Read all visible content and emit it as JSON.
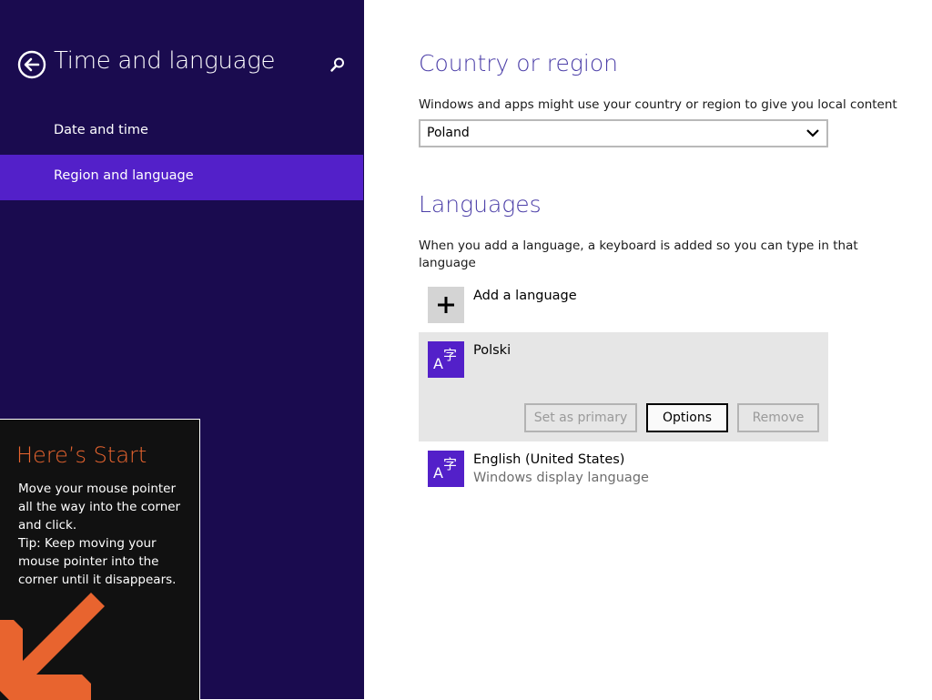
{
  "sidebar": {
    "title": "Time and language",
    "items": [
      {
        "label": "Date and time",
        "selected": false
      },
      {
        "label": "Region and language",
        "selected": true
      }
    ]
  },
  "tip": {
    "title": "Here’s Start",
    "lines": [
      "Move your mouse pointer",
      "all the way into the corner",
      "and click.",
      "Tip: Keep moving your",
      "mouse pointer into the",
      "corner until it disappears."
    ]
  },
  "country": {
    "heading": "Country or region",
    "description": "Windows and apps might use your country or region to give you local content",
    "selected_value": "Poland"
  },
  "languages": {
    "heading": "Languages",
    "description_line1": "When you add a language, a keyboard is added so you can type in that",
    "description_line2": "language",
    "add_label": "Add a language",
    "items": [
      {
        "name": "Polski",
        "sublabel": "",
        "selected": true,
        "buttons": {
          "set_primary": "Set as primary",
          "options": "Options",
          "remove": "Remove"
        }
      },
      {
        "name": "English (United States)",
        "sublabel": "Windows display language",
        "selected": false
      }
    ]
  },
  "icons": {
    "back": "back-arrow-icon",
    "search": "search-icon",
    "add": "plus-icon",
    "language": "language-icon",
    "dropdown": "chevron-down-icon",
    "tip_arrow": "arrow-down-left-icon"
  },
  "colors": {
    "sidebar_bg": "#1a0b4f",
    "accent": "#5320c9",
    "heading": "#4c3fa8",
    "tip_title": "#e8642f",
    "tip_arrow": "#e8642f"
  }
}
